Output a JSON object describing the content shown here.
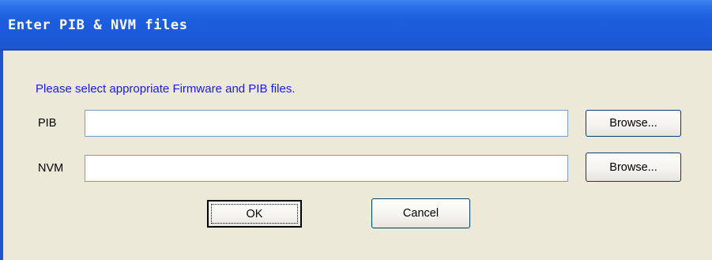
{
  "dialog": {
    "title": "Enter PIB & NVM files",
    "instruction": "Please select appropriate Firmware and PIB files."
  },
  "pib": {
    "label": "PIB",
    "value": "",
    "browse_label": "Browse..."
  },
  "nvm": {
    "label": "NVM",
    "value": "",
    "browse_label": "Browse..."
  },
  "buttons": {
    "ok_label": "OK",
    "cancel_label": "Cancel"
  },
  "colors": {
    "titlebar": "#1d5fe0",
    "dialog_bg": "#ece9d8",
    "instruction_text": "#1a1ae8"
  }
}
